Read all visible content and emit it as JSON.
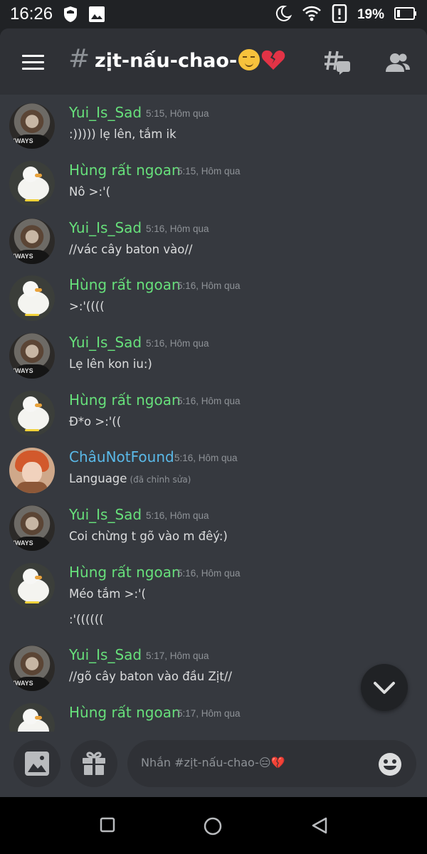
{
  "status_bar": {
    "time": "16:26",
    "battery": "19%",
    "icons": [
      "shield-icon",
      "image-icon",
      "moon-icon",
      "wifi-icon",
      "alert-icon",
      "battery-icon"
    ]
  },
  "header": {
    "hash": "#",
    "channel_name": "zịt-nấu-chao-",
    "menu_icon": "hamburger-icon",
    "threads_icon": "threads-icon",
    "members_icon": "members-icon"
  },
  "messages": [
    {
      "author": "Yui_Is_Sad",
      "avatar": "boy",
      "time": "5:15, Hôm qua",
      "lines": [
        ":))))) lẹ lên, tắm ik"
      ]
    },
    {
      "author": "Hùng rất ngoan",
      "avatar": "duck",
      "time": "5:15, Hôm qua",
      "lines": [
        "Nô >:'("
      ]
    },
    {
      "author": "Yui_Is_Sad",
      "avatar": "boy",
      "time": "5:16, Hôm qua",
      "lines": [
        "//vác cây baton vào//"
      ]
    },
    {
      "author": "Hùng rất ngoan",
      "avatar": "duck",
      "time": "5:16, Hôm qua",
      "lines": [
        ">:'(((("
      ]
    },
    {
      "author": "Yui_Is_Sad",
      "avatar": "boy",
      "time": "5:16, Hôm qua",
      "lines": [
        "Lẹ lên kon iu:)"
      ]
    },
    {
      "author": "Hùng rất ngoan",
      "avatar": "duck",
      "time": "5:16, Hôm qua",
      "lines": [
        "Đ*o >:'(("
      ]
    },
    {
      "author": "ChâuNotFound",
      "avatar": "chau",
      "time": "5:16, Hôm qua",
      "lines": [
        "Language"
      ],
      "edited": "(đã chỉnh sửa)"
    },
    {
      "author": "Yui_Is_Sad",
      "avatar": "boy",
      "time": "5:16, Hôm qua",
      "lines": [
        "Coi chừng t gõ vào m đêý:)"
      ]
    },
    {
      "author": "Hùng rất ngoan",
      "avatar": "duck",
      "time": "5:16, Hôm qua",
      "lines": [
        "Méo tắm >:'(",
        ":'(((((("
      ]
    },
    {
      "author": "Yui_Is_Sad",
      "avatar": "boy",
      "time": "5:17, Hôm qua",
      "lines": [
        "//gõ cây baton vào đầu Zịt//"
      ]
    },
    {
      "author": "Hùng rất ngoan",
      "avatar": "duck",
      "time": "5:17, Hôm qua",
      "lines": []
    }
  ],
  "avatar_shirt_text": "YWAYS",
  "composer": {
    "placeholder": "Nhắn #zịt-nấu-chao-😑💔",
    "image_icon": "image-icon",
    "gift_icon": "gift-icon",
    "emoji_icon": "emoji-icon"
  },
  "scroll_button_icon": "chevron-down-icon",
  "nav": [
    "recents-icon",
    "home-icon",
    "back-icon"
  ],
  "colors": {
    "background": "#36393f",
    "header": "#2f3136",
    "username_green": "#67e07b",
    "username_blue": "#5ab9e8",
    "text": "#dcddde",
    "muted": "#8e9297"
  }
}
